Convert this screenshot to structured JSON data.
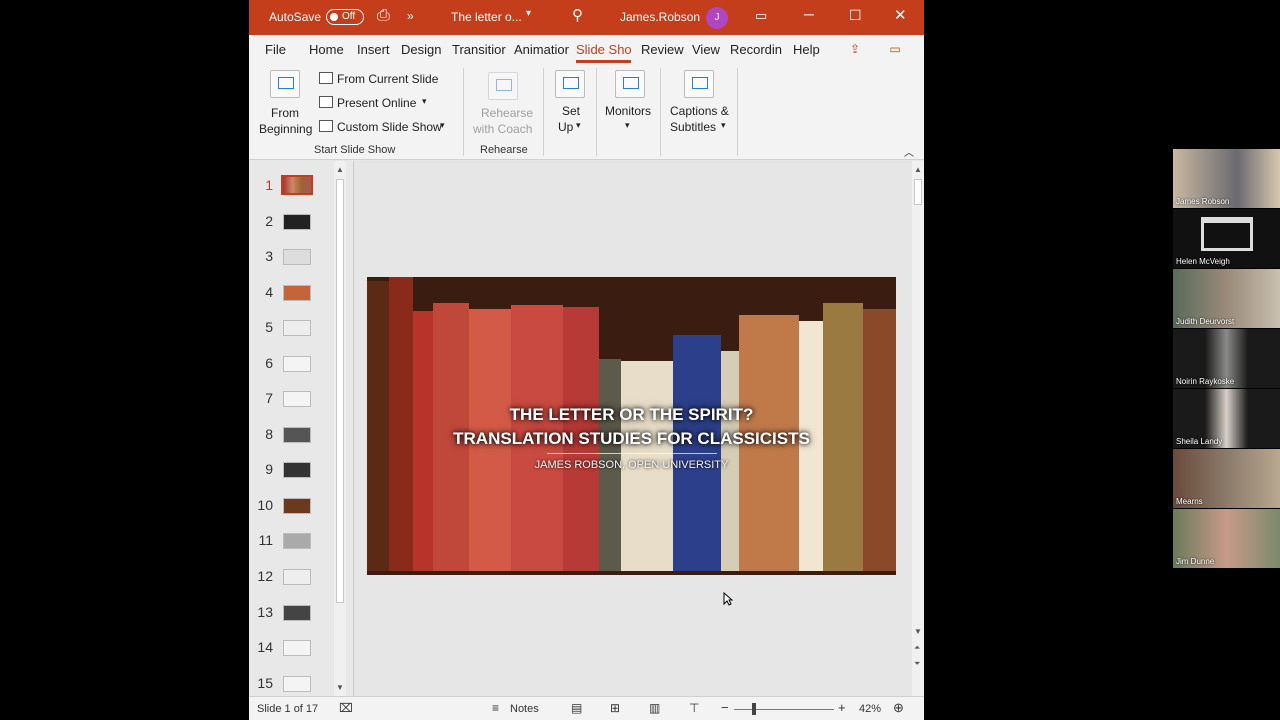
{
  "titlebar": {
    "autosave_label": "AutoSave",
    "autosave_state": "Off",
    "more_label": "»",
    "doc_title": "The letter o...",
    "user_name": "James.Robson",
    "user_initial": "J"
  },
  "menu": {
    "tabs": [
      "File",
      "Home",
      "Insert",
      "Design",
      "Transitior",
      "Animatior",
      "Slide Sho",
      "Review",
      "View",
      "Recordin",
      "Help"
    ],
    "active_tab": "Slide Sho"
  },
  "ribbon": {
    "from_beginning_1": "From",
    "from_beginning_2": "Beginning",
    "from_current": "From Current Slide",
    "present_online": "Present Online",
    "custom_show": "Custom Slide Show",
    "group_start": "Start Slide Show",
    "rehearse_1": "Rehearse",
    "rehearse_2": "with Coach",
    "group_rehearse": "Rehearse",
    "setup_1": "Set",
    "setup_2": "Up",
    "monitors": "Monitors",
    "captions_1": "Captions &",
    "captions_2": "Subtitles"
  },
  "slides": {
    "numbers": [
      "1",
      "2",
      "3",
      "4",
      "5",
      "6",
      "7",
      "8",
      "9",
      "10",
      "11",
      "12",
      "13",
      "14",
      "15"
    ],
    "active": "1"
  },
  "slide": {
    "title_line1": "THE LETTER OR THE SPIRIT?",
    "title_line2": "TRANSLATION STUDIES FOR CLASSICISTS",
    "subtitle": "JAMES ROBSON, OPEN UNIVERSITY"
  },
  "status": {
    "slide_count": "Slide 1 of 17",
    "notes": "Notes",
    "zoom": "42%"
  },
  "participants": [
    "James Robson",
    "Helen McVeigh",
    "Judith Deurvorst",
    "Noirin Raykoske",
    "Sheila Landy",
    "Mearns",
    "Jim Dunne"
  ],
  "colors": {
    "accent": "#c43e1c",
    "window_bg": "#e8e8e8"
  }
}
